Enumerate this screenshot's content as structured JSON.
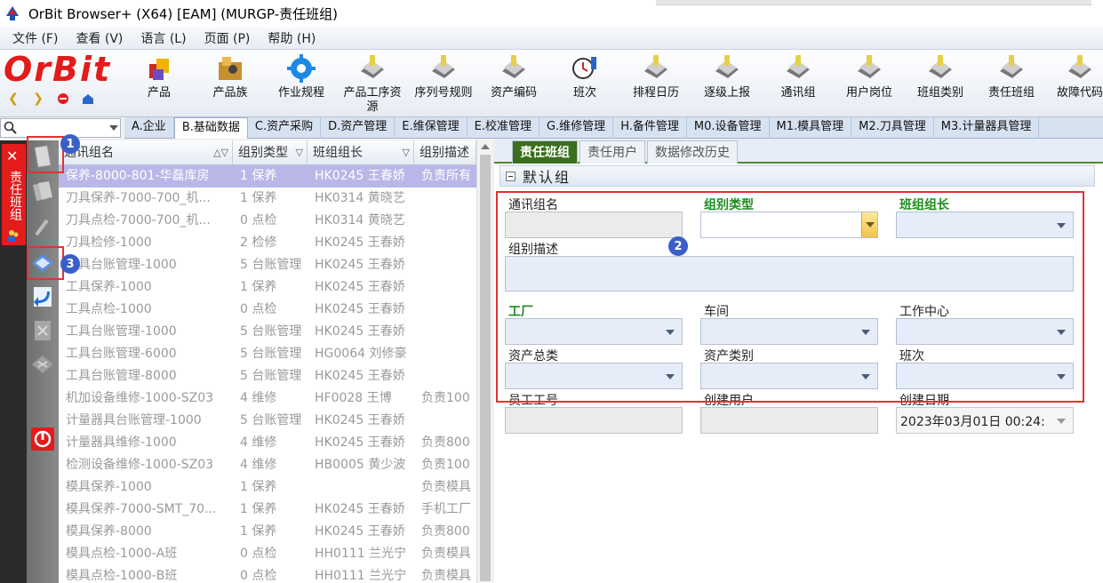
{
  "window": {
    "title": "OrBit Browser+ (X64) [EAM] (MURGP-责任班组)"
  },
  "menubar": {
    "items": [
      "文件 (F)",
      "查看 (V)",
      "语言 (L)",
      "页面 (P)",
      "帮助 (H)"
    ]
  },
  "logo": {
    "text": "OrBit"
  },
  "toolbar": {
    "buttons": [
      {
        "label": "产品",
        "icon": "product-icon"
      },
      {
        "label": "产品族",
        "icon": "product-family-icon"
      },
      {
        "label": "作业规程",
        "icon": "gear-icon"
      },
      {
        "label": "产品工序资源",
        "icon": "process-resource-icon"
      },
      {
        "label": "序列号规则",
        "icon": "serial-rule-icon"
      },
      {
        "label": "资产编码",
        "icon": "asset-code-icon"
      },
      {
        "label": "班次",
        "icon": "shift-clock-icon"
      },
      {
        "label": "排程日历",
        "icon": "calendar-icon"
      },
      {
        "label": "逐级上报",
        "icon": "escalation-icon"
      },
      {
        "label": "通讯组",
        "icon": "comm-group-icon"
      },
      {
        "label": "用户岗位",
        "icon": "user-position-icon"
      },
      {
        "label": "班组类别",
        "icon": "team-category-icon"
      },
      {
        "label": "责任班组",
        "icon": "responsible-team-icon"
      },
      {
        "label": "故障代码",
        "icon": "fault-code-icon"
      }
    ]
  },
  "module_tabs": [
    "A.企业",
    "B.基础数据",
    "C.资产采购",
    "D.资产管理",
    "E.维保管理",
    "E.校准管理",
    "G.维修管理",
    "H.备件管理",
    "M0.设备管理",
    "M1.模具管理",
    "M2.刀具管理",
    "M3.计量器具管理"
  ],
  "side_tab": {
    "label": "责任班组"
  },
  "grid": {
    "columns": [
      "通讯组名",
      "组别类型",
      "班组组长",
      "组别描述"
    ],
    "rows": [
      [
        "保养-8000-801-华磊库房",
        "1 保养",
        "HK0245 王春娇",
        "负责所有"
      ],
      [
        "刀具保养-7000-700_机...",
        "1 保养",
        "HK0314 黄晓艺",
        ""
      ],
      [
        "刀具点检-7000-700_机...",
        "0 点检",
        "HK0314 黄晓艺",
        ""
      ],
      [
        "刀具检修-1000",
        "2 检修",
        "HK0245 王春娇",
        ""
      ],
      [
        "刀具台账管理-1000",
        "5 台账管理",
        "HK0245 王春娇",
        ""
      ],
      [
        "工具保养-1000",
        "1 保养",
        "HK0245 王春娇",
        ""
      ],
      [
        "工具点检-1000",
        "0 点检",
        "HK0245 王春娇",
        ""
      ],
      [
        "工具台账管理-1000",
        "5 台账管理",
        "HK0245 王春娇",
        ""
      ],
      [
        "工具台账管理-6000",
        "5 台账管理",
        "HG0064 刘修豪",
        ""
      ],
      [
        "工具台账管理-8000",
        "5 台账管理",
        "HK0245 王春娇",
        ""
      ],
      [
        "机加设备维修-1000-SZ03",
        "4 维修",
        "HF0028 王博",
        "负责100"
      ],
      [
        "计量器具台账管理-1000",
        "5 台账管理",
        "HK0245 王春娇",
        ""
      ],
      [
        "计量器具维修-1000",
        "4 维修",
        "HK0245 王春娇",
        "负责800"
      ],
      [
        "检测设备维修-1000-SZ03",
        "4 维修",
        "HB0005 黄少波",
        "负责100"
      ],
      [
        "模具保养-1000",
        "1 保养",
        "",
        "负责模具"
      ],
      [
        "模具保养-7000-SMT_70...",
        "1 保养",
        "HK0245 王春娇",
        "手机工厂"
      ],
      [
        "模具保养-8000",
        "1 保养",
        "HK0245 王春娇",
        "负责800"
      ],
      [
        "模具点检-1000-A班",
        "0 点检",
        "HH0111 兰光宁",
        "负责模具"
      ],
      [
        "模具点检-1000-B班",
        "0 点检",
        "HH0111 兰光宁",
        "负责模具"
      ]
    ]
  },
  "detail": {
    "tabs": [
      "责任班组",
      "责任用户",
      "数据修改历史"
    ],
    "section_title": "默认组",
    "labels": {
      "group_name": "通讯组名",
      "group_type": "组别类型",
      "team_leader": "班组组长",
      "group_desc": "组别描述",
      "plant": "工厂",
      "workshop": "车间",
      "work_center": "工作中心",
      "asset_class": "资产总类",
      "asset_category": "资产类别",
      "shift": "班次",
      "employee_no": "员工工号",
      "created_by": "创建用户",
      "created_date": "创建日期"
    },
    "values": {
      "created_date": "2023年03月01日 00:24:"
    }
  },
  "annotations": [
    "1",
    "2",
    "3"
  ],
  "colors": {
    "highlight": "#e23232",
    "badge": "#3b5fc9",
    "required_label": "#1f8c1f",
    "active_subtab": "#3a6f1e",
    "selected_row": "#b9b7e8"
  }
}
